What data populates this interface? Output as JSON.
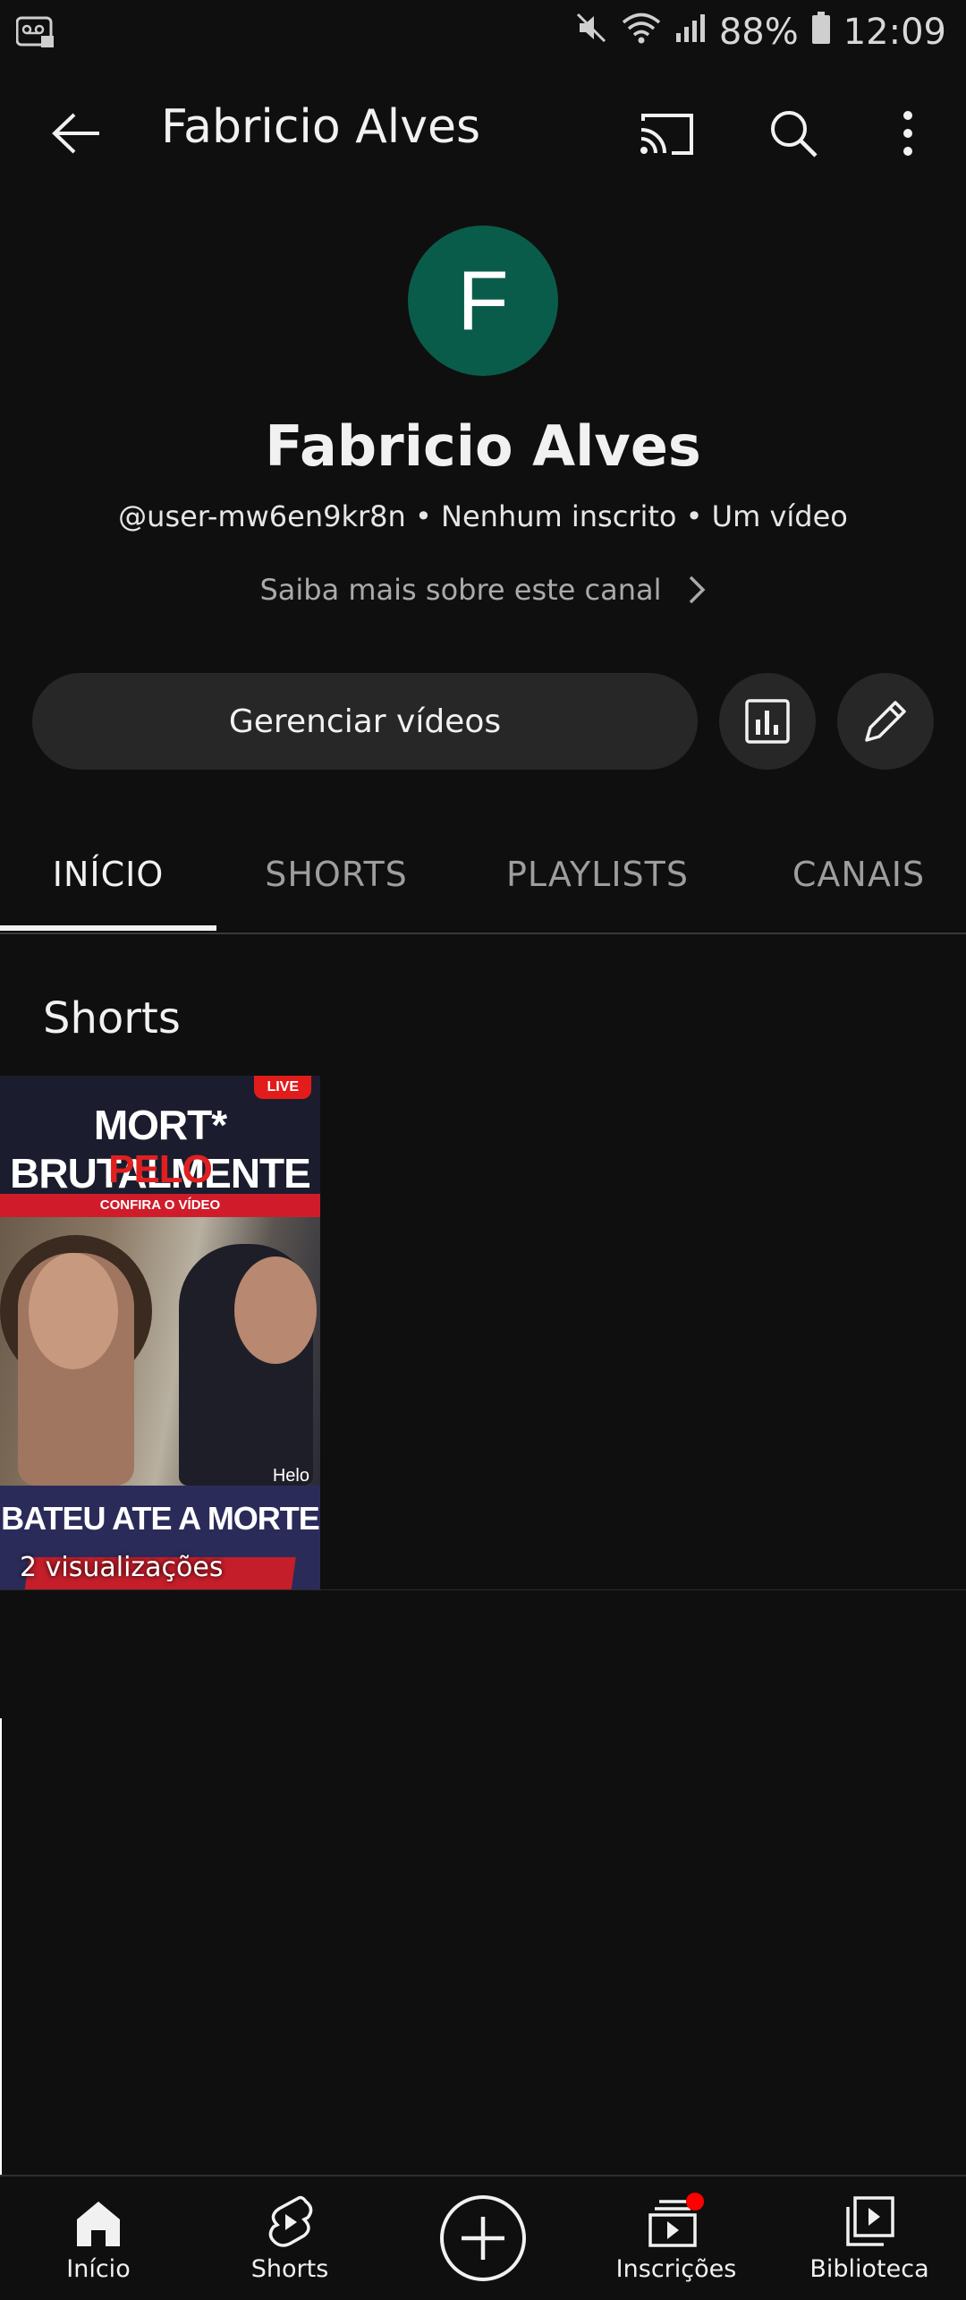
{
  "status_bar": {
    "battery": "88%",
    "time": "12:09"
  },
  "app_bar": {
    "title": "Fabricio Alves"
  },
  "channel": {
    "avatar_letter": "F",
    "avatar_color": "#0a5c4a",
    "name": "Fabricio Alves",
    "meta": "@user-mw6en9kr8n • Nenhum inscrito • Um vídeo",
    "about_link": "Saiba mais sobre este canal"
  },
  "actions": {
    "manage_videos": "Gerenciar vídeos"
  },
  "tabs": [
    {
      "label": "INÍCIO",
      "active": true
    },
    {
      "label": "SHORTS",
      "active": false
    },
    {
      "label": "PLAYLISTS",
      "active": false
    },
    {
      "label": "CANAIS",
      "active": false
    }
  ],
  "shorts_section": {
    "title": "Shorts",
    "items": [
      {
        "thumbnail_text_1": "MORT* BRUTALMENTE",
        "thumbnail_text_2": "PELO COMPANHEIRO",
        "thumbnail_strip": "CONFIRA O VÍDEO",
        "thumbnail_badge": "LIVE",
        "thumbnail_watermark": "Helo",
        "thumbnail_bottom": "BATEU ATE A MORTE",
        "views": "2 visualizações"
      }
    ]
  },
  "bottom_nav": [
    {
      "label": "Início",
      "icon": "home-icon"
    },
    {
      "label": "Shorts",
      "icon": "shorts-icon"
    },
    {
      "label": "",
      "icon": "create-icon"
    },
    {
      "label": "Inscrições",
      "icon": "subscriptions-icon"
    },
    {
      "label": "Biblioteca",
      "icon": "library-icon"
    }
  ],
  "colors": {
    "background": "#0f0f0f",
    "button_bg": "#272727",
    "notification_dot": "#ff0000"
  }
}
